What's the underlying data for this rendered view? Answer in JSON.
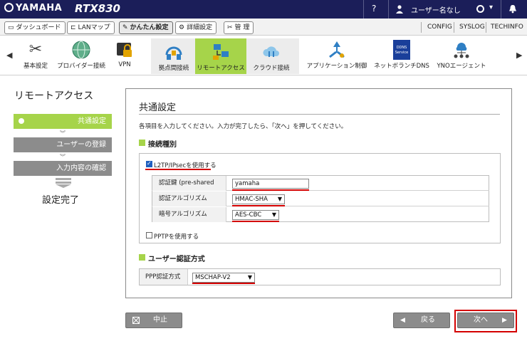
{
  "header": {
    "brand": "YAMAHA",
    "model": "RTX830",
    "help": "?",
    "user": "ユーザー名なし",
    "status_icon": "O",
    "menu_chevron": "▾",
    "bell_icon": "bell-icon"
  },
  "nav": {
    "tabs": [
      {
        "label": "ダッシュボード",
        "icon": "monitor-icon"
      },
      {
        "label": "LANマップ",
        "icon": "lan-map-icon"
      },
      {
        "label": "かんたん設定",
        "icon": "wand-icon"
      },
      {
        "label": "詳細設定",
        "icon": "gear-icon"
      },
      {
        "label": "管  理",
        "icon": "wrench-icon"
      }
    ],
    "links": [
      "CONFIG",
      "SYSLOG",
      "TECHINFO"
    ]
  },
  "icons": {
    "prev": "◀",
    "next": "▶",
    "items": [
      {
        "label": "基本設定",
        "icon": "tools-icon"
      },
      {
        "label": "プロバイダー接続",
        "icon": "globe-icon"
      },
      {
        "label": "VPN",
        "icon": "lock-icon"
      },
      {
        "label": "拠点間接続",
        "icon": "site-to-site-icon"
      },
      {
        "label": "リモートアクセス",
        "icon": "remote-access-icon"
      },
      {
        "label": "クラウド接続",
        "icon": "cloud-icon"
      },
      {
        "label": "アプリケーション制御",
        "icon": "app-control-icon"
      },
      {
        "label": "ネットボランチDNS",
        "icon": "dns-icon",
        "badge": "DDNS Service"
      },
      {
        "label": "YNOエージェント",
        "icon": "yno-icon"
      }
    ]
  },
  "sidebar": {
    "title": "リモートアクセス",
    "steps": [
      "共通設定",
      "ユーザーの登録",
      "入力内容の確認"
    ],
    "done": "設定完了"
  },
  "main": {
    "title": "共通設定",
    "description": "各項目を入力してください。入力が完了したら、「次へ」を押してください。",
    "section1": {
      "heading": "接続種別",
      "l2tp_label": "L2TP/IPsecを使用する",
      "l2tp_checked": true,
      "rows": [
        {
          "label": "認証鍵 (pre-shared key)",
          "value": "yamaha"
        },
        {
          "label": "認証アルゴリズム",
          "value": "HMAC-SHA"
        },
        {
          "label": "暗号アルゴリズム",
          "value": "AES-CBC"
        }
      ],
      "pptp_label": "PPTPを使用する",
      "pptp_checked": false
    },
    "section2": {
      "heading": "ユーザー認証方式",
      "ppp_label": "PPP認証方式",
      "ppp_value": "MSCHAP-V2"
    }
  },
  "footer": {
    "cancel": "中止",
    "back": "戻る",
    "next": "次へ"
  },
  "colors": {
    "header_bg": "#1b1e59",
    "accent_green": "#a6d44a",
    "step_inactive": "#8c8c8c",
    "highlight_red": "#d40000"
  }
}
